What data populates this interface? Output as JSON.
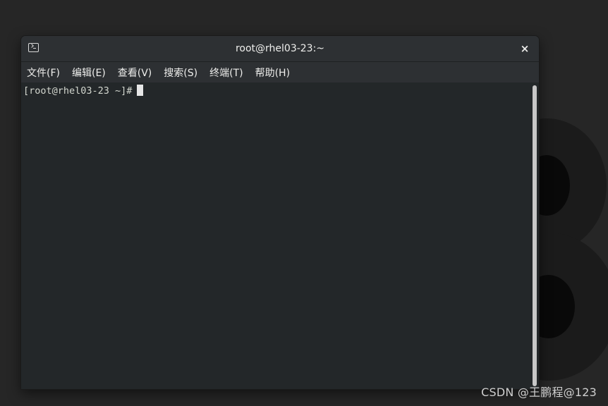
{
  "window": {
    "title": "root@rhel03-23:~",
    "close_label": "×",
    "icon": "terminal-icon"
  },
  "menu": {
    "items": [
      {
        "label": "文件(F)"
      },
      {
        "label": "编辑(E)"
      },
      {
        "label": "查看(V)"
      },
      {
        "label": "搜索(S)"
      },
      {
        "label": "终端(T)"
      },
      {
        "label": "帮助(H)"
      }
    ]
  },
  "terminal": {
    "prompt": "[root@rhel03-23 ~]#"
  },
  "watermark": {
    "text": "CSDN @王鹏程@123"
  },
  "colors": {
    "desktop_bg": "#262626",
    "titlebar_bg": "#2d3033",
    "terminal_bg": "#232729",
    "text": "#eeeeec"
  }
}
